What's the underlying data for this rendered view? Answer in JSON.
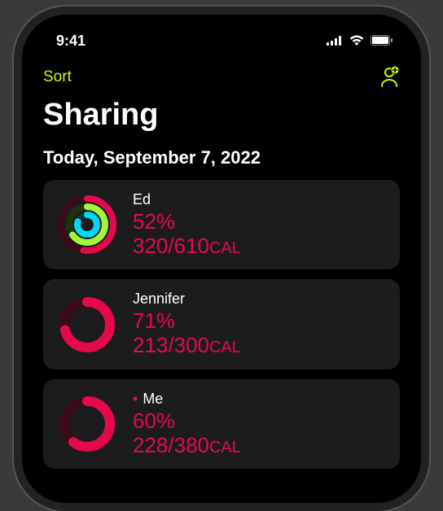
{
  "status": {
    "time": "9:41"
  },
  "nav": {
    "sort_label": "Sort"
  },
  "header": {
    "title": "Sharing",
    "date": "Today, September 7, 2022"
  },
  "colors": {
    "accent": "#c3ff00",
    "move": "#e5094b",
    "exercise": "#a3f53a",
    "stand": "#00d7f5",
    "ring_bg": "#3a0b18"
  },
  "cal_unit": "CAL",
  "people": [
    {
      "name": "Ed",
      "is_me": false,
      "percent": "52%",
      "progress": "320/610",
      "rings": {
        "move": 0.52,
        "exercise": 0.65,
        "stand": 0.8,
        "multi": true
      }
    },
    {
      "name": "Jennifer",
      "is_me": false,
      "percent": "71%",
      "progress": "213/300",
      "rings": {
        "move": 0.71,
        "multi": false
      }
    },
    {
      "name": "Me",
      "is_me": true,
      "percent": "60%",
      "progress": "228/380",
      "rings": {
        "move": 0.6,
        "multi": false
      }
    }
  ]
}
